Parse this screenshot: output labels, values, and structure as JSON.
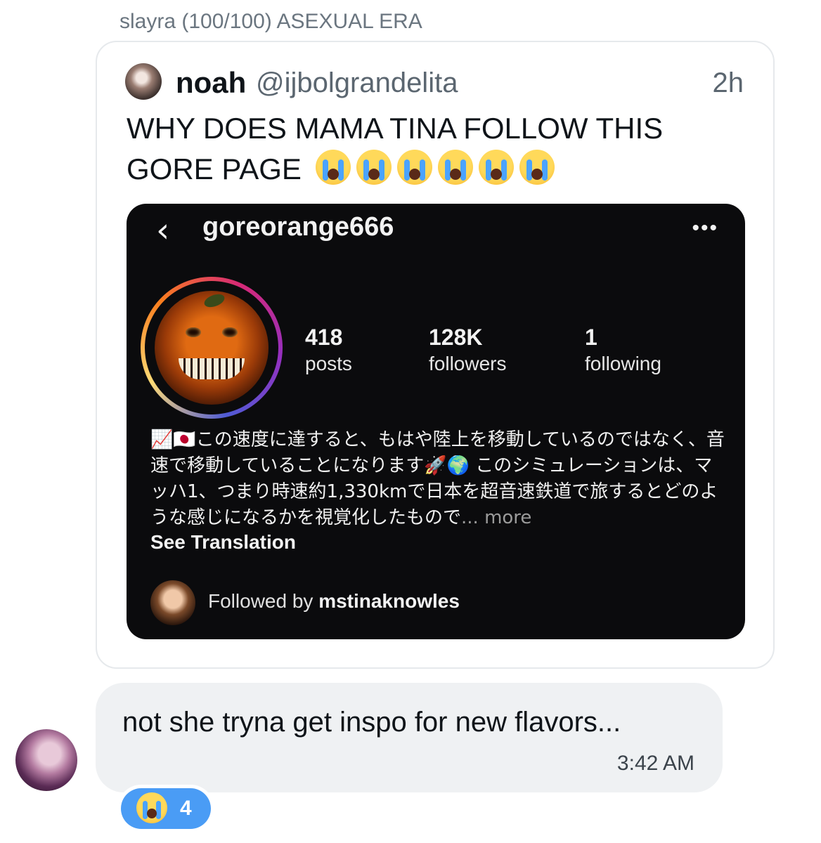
{
  "sender_name": "slayra (100/100) ASEXUAL ERA",
  "quoted_tweet": {
    "avatar": "user-avatar",
    "name": "noah",
    "handle": "@ijbolgrandelita",
    "time": "2h",
    "text": "WHY DOES MAMA TINA FOLLOW THIS GORE PAGE",
    "emoji_icon": "loudly-crying-face-icon",
    "emoji_count": 6
  },
  "instagram": {
    "back_icon": "back-chevron-icon",
    "username": "goreorange666",
    "more_icon": "more-dots-icon",
    "more_label": "•••",
    "back_label": "‹",
    "stats": [
      {
        "value": "418",
        "label": "posts"
      },
      {
        "value": "128K",
        "label": "followers"
      },
      {
        "value": "1",
        "label": "following"
      }
    ],
    "bio": "📈🇯🇵この速度に達すると、もはや陸上を移動しているのではなく、音速で移動していることになります🚀🌍 このシミュレーションは、マッハ1、つまり時速約1,330kmで日本を超音速鉄道で旅するとどのような感じになるかを視覚化したもので",
    "bio_more": "... more",
    "see_translation": "See Translation",
    "followed_by_prefix": "Followed by",
    "followed_by_user": "mstinaknowles"
  },
  "message": {
    "text": "not she tryna get inspo for new flavors...",
    "time": "3:42 AM",
    "reaction_icon": "loudly-crying-face-icon",
    "reaction_count": "4"
  }
}
